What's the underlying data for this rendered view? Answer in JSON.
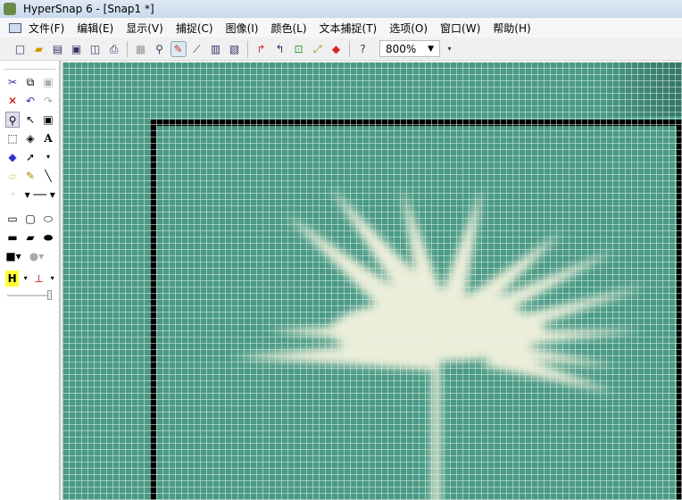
{
  "window": {
    "title": "HyperSnap 6 - [Snap1 *]"
  },
  "menu": [
    "文件(F)",
    "编辑(E)",
    "显示(V)",
    "捕捉(C)",
    "图像(I)",
    "颜色(L)",
    "文本捕捉(T)",
    "选项(O)",
    "窗口(W)",
    "帮助(H)"
  ],
  "toolbar": {
    "zoom_value": "800%"
  },
  "colors": {
    "canvas": "#4a9a86",
    "flower": "#efeed8",
    "border": "#000000"
  }
}
